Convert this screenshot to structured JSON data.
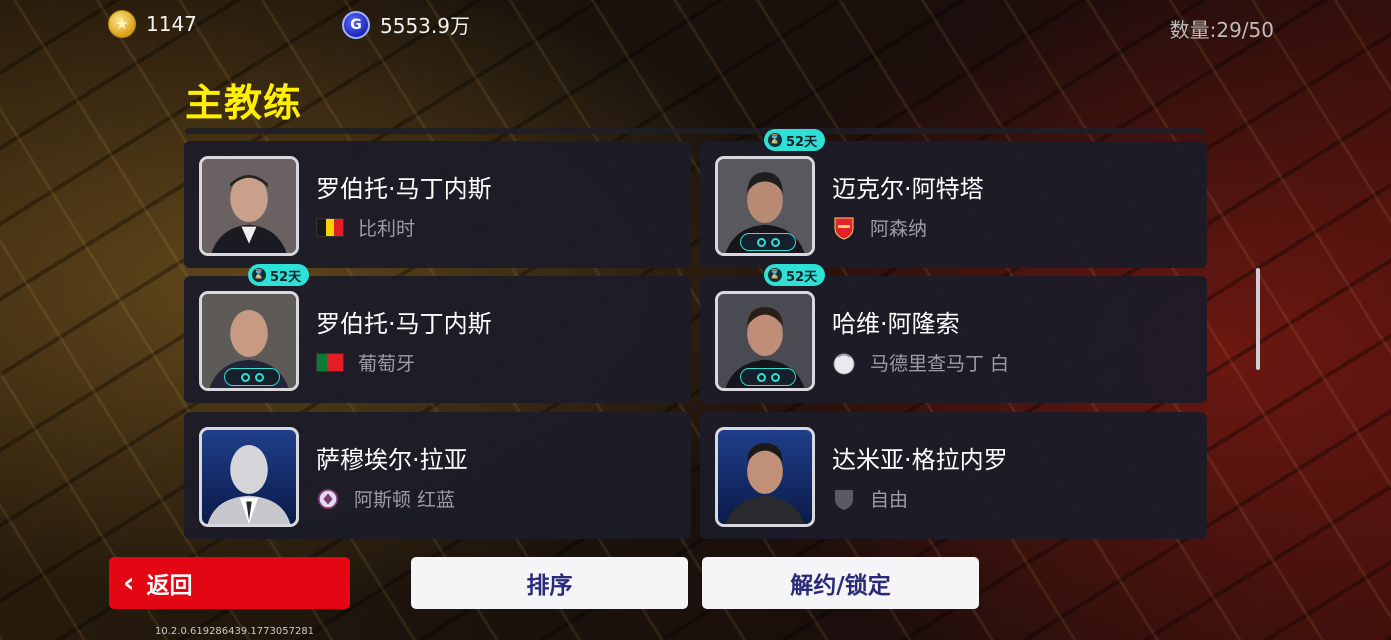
{
  "topbar": {
    "coins": "1147",
    "gp": "5553.9万",
    "count": "数量:29/50",
    "coin_icon_glyph": "★",
    "gp_icon_glyph": "G"
  },
  "section_title": "主教练",
  "cards": [
    {
      "name": "罗伯托·马丁内斯",
      "meta": "比利时",
      "badge": null,
      "meta_icon": "belgium-flag",
      "flag_colors": [
        "#1a1a1a",
        "#f5d400",
        "#e31d23"
      ]
    },
    {
      "name": "迈克尔·阿特塔",
      "meta": "阿森纳",
      "badge": "52天",
      "meta_icon": "arsenal-crest"
    },
    {
      "name": "罗伯托·马丁内斯",
      "meta": "葡萄牙",
      "badge": "52天",
      "meta_icon": "portugal-flag",
      "flag_colors": [
        "#0b7a34",
        "#e41c23"
      ]
    },
    {
      "name": "哈维·阿隆索",
      "meta": "马德里查马丁 白",
      "badge": "52天",
      "meta_icon": "madrid-chamartin-crest"
    },
    {
      "name": "萨穆埃尔·拉亚",
      "meta": "阿斯顿 红蓝",
      "badge": null,
      "meta_icon": "aston-crest"
    },
    {
      "name": "达米亚·格拉内罗",
      "meta": "自由",
      "badge": null,
      "meta_icon": "free-agent-shield"
    }
  ],
  "buttons": {
    "back": "返回",
    "sort": "排序",
    "unlock_lock": "解约/锁定"
  },
  "version": "10.2.0.619286439.1773057281",
  "colors": {
    "title_yellow": "#ffef00",
    "back_red": "#e30613",
    "badge_cyan": "#2fe0d4",
    "card_bg": "#1c1c28"
  }
}
